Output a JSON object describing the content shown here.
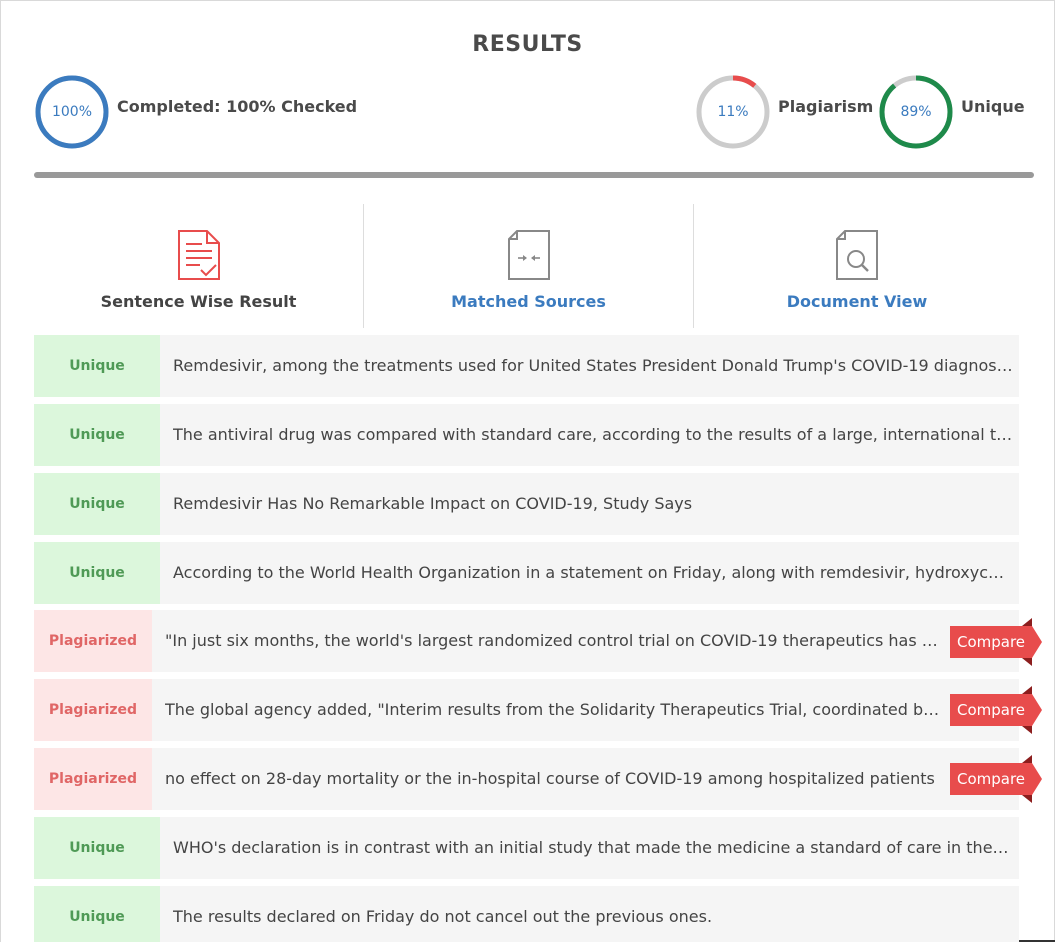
{
  "title": "RESULTS",
  "colors": {
    "blue": "#3b7bbf",
    "red": "#e84c4c",
    "green": "#1e8a4a",
    "track": "#cccccc"
  },
  "progress": {
    "value_pct": 100,
    "value_text": "100%",
    "label": "Completed: 100% Checked"
  },
  "plagiarism": {
    "value_pct": 11,
    "value_text": "11%",
    "label": "Plagiarism"
  },
  "unique": {
    "value_pct": 89,
    "value_text": "89%",
    "label": "Unique"
  },
  "tabs": [
    {
      "label": "Sentence Wise Result",
      "icon": "document-check-icon",
      "active": true
    },
    {
      "label": "Matched Sources",
      "icon": "compare-document-icon",
      "active": false
    },
    {
      "label": "Document View",
      "icon": "document-search-icon",
      "active": false
    }
  ],
  "compare_label": "Compare",
  "rows": [
    {
      "status": "Unique",
      "text": "Remdesivir, among the treatments used for United States President Donald Trump's COVID-19 diagnosis, has no remarkable impact"
    },
    {
      "status": "Unique",
      "text": "The antiviral drug was compared with standard care, according to the results of a large, international trial"
    },
    {
      "status": "Unique",
      "text": "Remdesivir Has No Remarkable Impact on COVID-19, Study Says"
    },
    {
      "status": "Unique",
      "text": "According to the World Health Organization in a statement on Friday, along with remdesivir, hydroxychloroquine"
    },
    {
      "status": "Plagiarized",
      "text": "\"In just six months, the world's largest randomized control trial on COVID-19 therapeutics has generated"
    },
    {
      "status": "Plagiarized",
      "text": "The global agency added, \"Interim results from the Solidarity Therapeutics Trial, coordinated by the World Health Organization"
    },
    {
      "status": "Plagiarized",
      "text": "no effect on 28-day mortality or the in-hospital course of COVID-19 among hospitalized patients"
    },
    {
      "status": "Unique",
      "text": "WHO's declaration is in contrast with an initial study that made the medicine a standard of care in the United States"
    },
    {
      "status": "Unique",
      "text": "The results declared on Friday do not cancel out the previous ones."
    }
  ]
}
